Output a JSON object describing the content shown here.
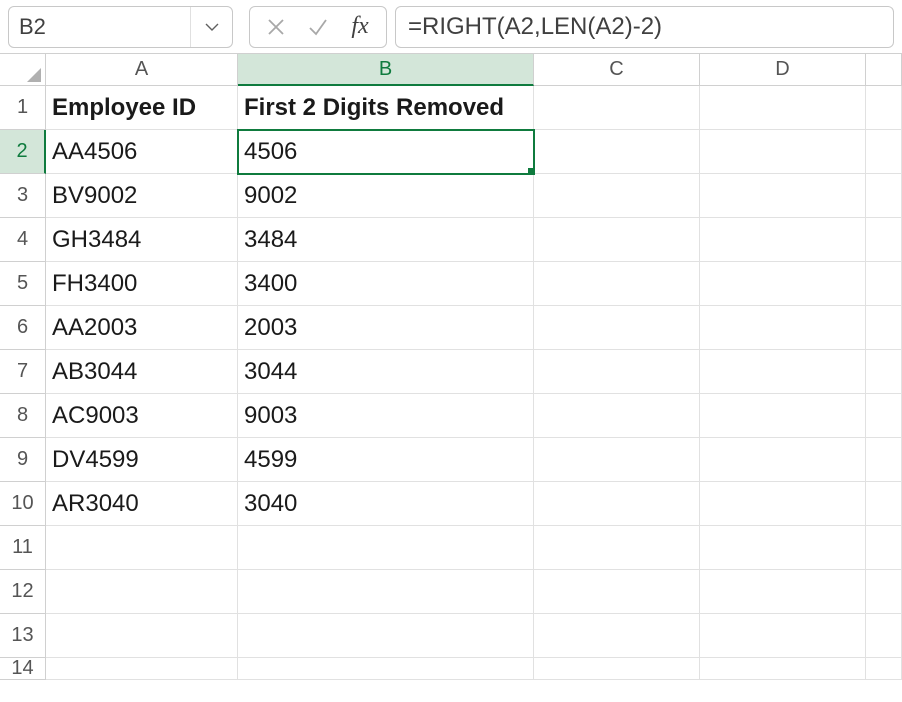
{
  "nameBox": {
    "value": "B2"
  },
  "formulaBar": {
    "value": "=RIGHT(A2,LEN(A2)-2)"
  },
  "columns": [
    "A",
    "B",
    "C",
    "D"
  ],
  "selected": {
    "col": "B",
    "row": 2
  },
  "headerRow": {
    "A": "Employee ID",
    "B": "First 2 Digits Removed"
  },
  "rows": [
    {
      "n": 2,
      "A": "AA4506",
      "B": "4506"
    },
    {
      "n": 3,
      "A": "BV9002",
      "B": "9002"
    },
    {
      "n": 4,
      "A": "GH3484",
      "B": "3484"
    },
    {
      "n": 5,
      "A": "FH3400",
      "B": "3400"
    },
    {
      "n": 6,
      "A": "AA2003",
      "B": "2003"
    },
    {
      "n": 7,
      "A": "AB3044",
      "B": "3044"
    },
    {
      "n": 8,
      "A": "AC9003",
      "B": "9003"
    },
    {
      "n": 9,
      "A": "DV4599",
      "B": "4599"
    },
    {
      "n": 10,
      "A": "AR3040",
      "B": "3040"
    },
    {
      "n": 11,
      "A": "",
      "B": ""
    },
    {
      "n": 12,
      "A": "",
      "B": ""
    },
    {
      "n": 13,
      "A": "",
      "B": ""
    },
    {
      "n": 14,
      "A": "",
      "B": ""
    }
  ]
}
